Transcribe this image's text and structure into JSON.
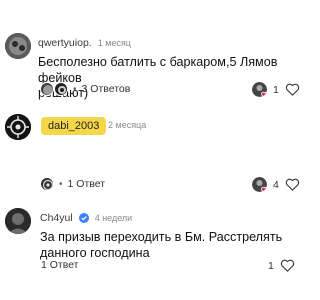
{
  "comments": [
    {
      "username": "qwertyuiop.",
      "time": "1 месяц",
      "text_line1": "Бесполезно батлить с баркаром,5 Лямов фейков",
      "text_line2": "решают)",
      "replies": "3 Ответов",
      "likes": "1"
    },
    {
      "username": "dabi_2003",
      "time": "2 месяца",
      "replies": "1 Ответ",
      "likes": "4"
    },
    {
      "username": "Ch4yul",
      "time": "4 недели",
      "text_line1": "За призыв переходить в Бм. Расстрелять",
      "text_line2": "данного господина",
      "replies": "1 Ответ",
      "likes": "1"
    }
  ],
  "separator": "•",
  "colors": {
    "tag_bg": "#f5d84a",
    "verified": "#3b82f6",
    "heart_red": "#e0245e"
  },
  "icons": [
    "avatar",
    "verified-icon",
    "heart-outline-icon",
    "creator-heart-icon"
  ]
}
